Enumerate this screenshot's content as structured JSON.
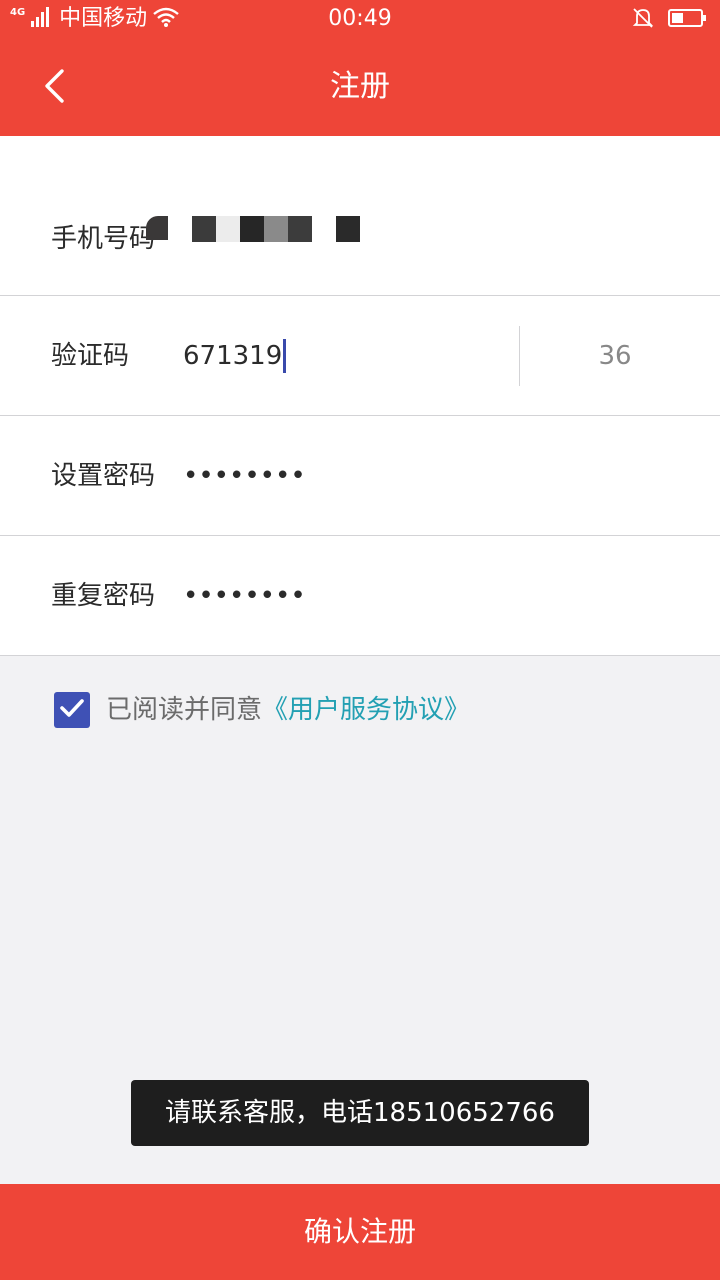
{
  "status_bar": {
    "network": "4G",
    "carrier": "中国移动",
    "time": "00:49"
  },
  "header": {
    "title": "注册"
  },
  "form": {
    "phone": {
      "label": "手机号码",
      "value_masked": true
    },
    "code": {
      "label": "验证码",
      "value": "671319",
      "countdown": "36"
    },
    "password": {
      "label": "设置密码",
      "value": "••••••••"
    },
    "repeat_password": {
      "label": "重复密码",
      "value": "••••••••"
    }
  },
  "agreement": {
    "checked": true,
    "text": "已阅读并同意",
    "link": "《用户服务协议》"
  },
  "toast": {
    "text": "请联系客服，电话18510652766"
  },
  "submit": {
    "label": "确认注册"
  },
  "colors": {
    "brand_red": "#ee4538",
    "checkbox_blue": "#3f51b5",
    "link_teal": "#23a0b3"
  }
}
